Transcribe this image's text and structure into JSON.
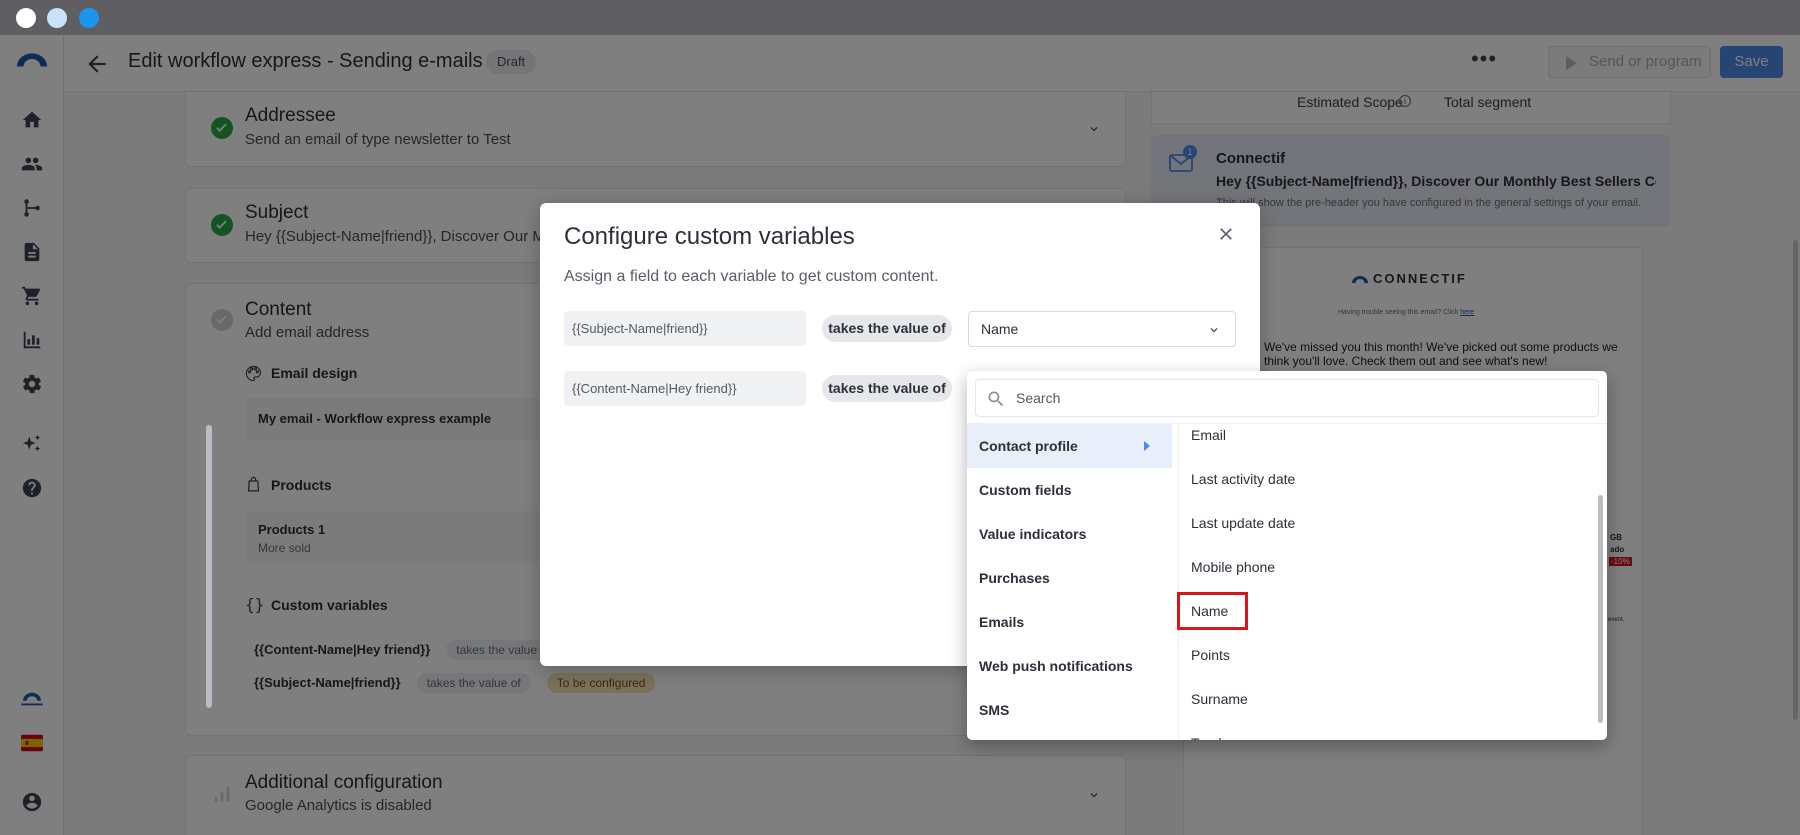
{
  "os_bar": {
    "dots": [
      "#ffffff",
      "#c6e3fb",
      "#1a96f0"
    ]
  },
  "header": {
    "title": "Edit workflow express - Sending e-mails",
    "badge": "Draft",
    "send_label": "Send or program",
    "save_label": "Save"
  },
  "sections": {
    "addressee": {
      "title": "Addressee",
      "subtitle": "Send an email of type newsletter to Test"
    },
    "subject": {
      "title": "Subject",
      "subtitle": "Hey {{Subject-Name|friend}}, Discover Our M"
    },
    "content": {
      "title": "Content",
      "subtitle": "Add email address",
      "email_design_label": "Email design",
      "email_design_value": "My email - Workflow express example",
      "products_label": "Products",
      "products_title": "Products 1",
      "products_sub": "More sold",
      "custom_vars_label": "Custom variables",
      "custom_vars": [
        {
          "name": "{{Content-Name|Hey friend}}",
          "takes": "takes the value of",
          "status": ""
        },
        {
          "name": "{{Subject-Name|friend}}",
          "takes": "takes the value of",
          "status": "To be configured"
        }
      ]
    },
    "additional": {
      "title": "Additional configuration",
      "subtitle": "Google Analytics is disabled"
    }
  },
  "right_panel": {
    "scope_label": "Estimated Scope",
    "segment_label": "Total segment",
    "sender": "Connectif",
    "mail_count": "1",
    "subject_preview": "Hey {{Subject-Name|friend}}, Discover Our Monthly Best Sellers Collecti...",
    "preheader_note": "This will show the pre-header you have configured in the general settings of your email.",
    "preview_logo": "CONNECTIF",
    "preview_trouble": "Having trouble seeing this email? Click",
    "preview_trouble_link": "here",
    "preview_body": "We've missed you this month! We've picked out some products we think you'll love. Check them out and see what's new!",
    "preview_frag1": "GB",
    "preview_frag2": "ado",
    "preview_frag3": "-10%",
    "preview_frag4": "event."
  },
  "dialog": {
    "title": "Configure custom variables",
    "description": "Assign a field to each variable to get custom content.",
    "rows": [
      {
        "variable": "{{Subject-Name|friend}}",
        "takes": "takes the value of",
        "selected": "Name"
      },
      {
        "variable": "{{Content-Name|Hey friend}}",
        "takes": "takes the value of",
        "selected": ""
      }
    ]
  },
  "dropdown": {
    "search_placeholder": "Search",
    "categories": [
      "Contact profile",
      "Custom fields",
      "Value indicators",
      "Purchases",
      "Emails",
      "Web push notifications",
      "SMS"
    ],
    "active_category": "Contact profile",
    "options": [
      "Email",
      "Last activity date",
      "Last update date",
      "Mobile phone",
      "Name",
      "Points",
      "Surname",
      "Tracker"
    ],
    "highlighted_option": "Name"
  },
  "colors": {
    "accent": "#4e8ae8",
    "success": "#27a844",
    "highlight": "#d9151b",
    "warning_pill": "#f6e2b8"
  }
}
